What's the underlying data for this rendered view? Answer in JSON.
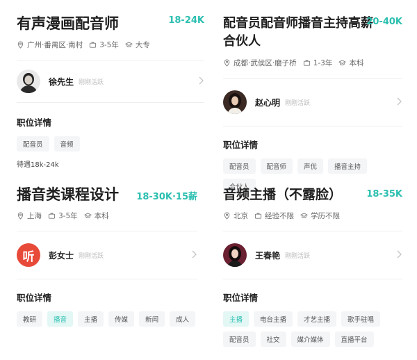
{
  "cards": [
    {
      "title": "有声漫画配音师",
      "salary": "18-24K",
      "location": "广州·番禺区·南村",
      "experience": "3-5年",
      "education": "大专",
      "recruiter_name": "徐先生",
      "recruiter_status": "刚刚活跃",
      "section_label": "职位详情",
      "tags": [
        "配音员",
        "音频"
      ],
      "treatment": "待遇18k-24k"
    },
    {
      "title_line1": "配音员配音师播音主持高薪",
      "title_line2": "合伙人",
      "salary": "20-40K",
      "location": "成都·武侯区·磨子桥",
      "experience": "1-3年",
      "education": "本科",
      "recruiter_name": "赵心明",
      "recruiter_status": "刚刚活跃",
      "section_label": "职位详情",
      "tags": [
        "配音员",
        "配音师",
        "声优",
        "播音主持",
        "合伙人"
      ]
    },
    {
      "title": "播音类课程设计",
      "salary": "18-30K·15薪",
      "location": "上海",
      "experience": "3-5年",
      "education": "本科",
      "recruiter_name": "彭女士",
      "recruiter_status": "刚刚活跃",
      "avatar_glyph": "听",
      "section_label": "职位详情",
      "tags": [
        "教研",
        "播音",
        "主播",
        "传媒",
        "新闻",
        "成人"
      ],
      "highlighted_tag": "播音"
    },
    {
      "title": "音频主播（不露脸）",
      "salary": "18-35K",
      "location": "北京",
      "experience": "经验不限",
      "education": "学历不限",
      "recruiter_name": "王春艳",
      "recruiter_status": "刚刚活跃",
      "section_label": "职位详情",
      "tags": [
        "主播",
        "电台主播",
        "才艺主播",
        "歌手驻唱",
        "配音员",
        "社交",
        "媒介媒体",
        "直播平台"
      ],
      "highlighted_tag": "主播"
    }
  ],
  "colors": {
    "accent": "#2bbfb0",
    "tag_bg": "#f4f5f7",
    "tag_hl_bg": "#e3f7f5",
    "avatar_red": "#e84a3a"
  }
}
